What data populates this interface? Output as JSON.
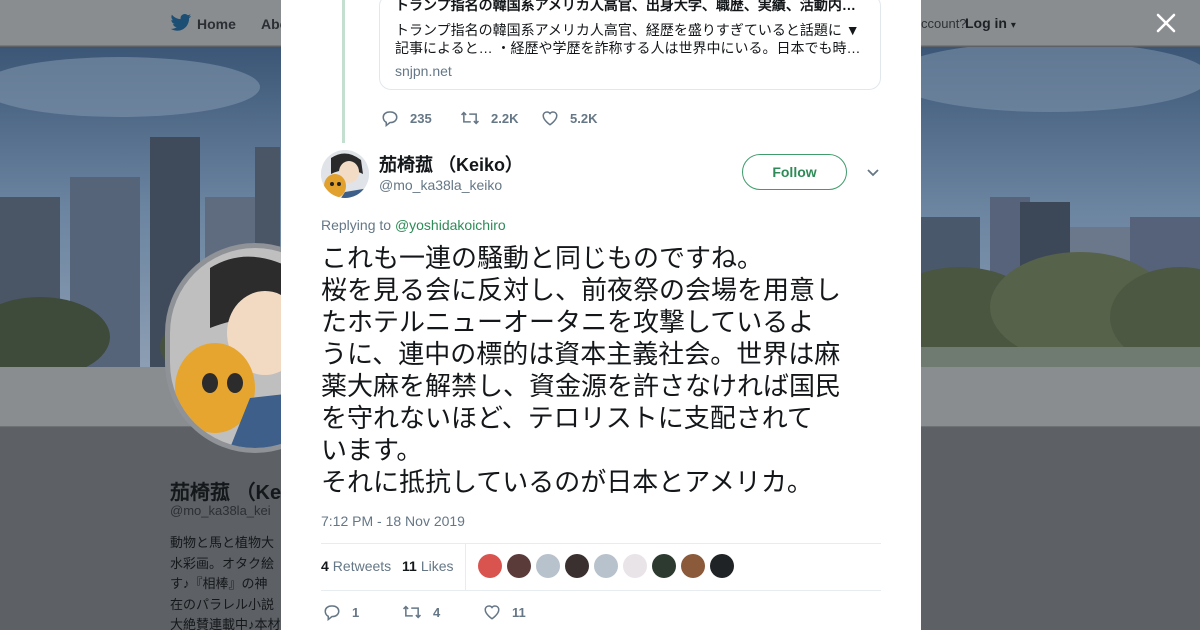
{
  "nav": {
    "home_label": "Home",
    "about_label": "Abo",
    "account_label": "ccount?",
    "login_label": "Log in"
  },
  "profile": {
    "name": "茄椅菰 （Ke",
    "handle": "@mo_ka38la_kei",
    "bio_lines": [
      "動物と馬と植物大",
      "水彩画。オタク絵",
      "す♪『相棒』の神",
      "在のパラレル小説",
      "大絶賛連載中♪本材"
    ]
  },
  "quoted_card": {
    "title": "トランプ指名の韓国系アメリカ人高官、出身大学、職歴、実績、活動内…",
    "desc_lines": [
      "トランプ指名の韓国系アメリカ人高官、経歴を盛りすぎていると話題に ▼",
      "記事によると… ・経歴や学歴を詐称する人は世界中にいる。日本でも時…"
    ],
    "domain": "snjpn.net"
  },
  "prev_actions": {
    "replies": "235",
    "retweets": "2.2K",
    "likes": "5.2K"
  },
  "tweet": {
    "author_name": "茄椅菰 （Keiko）",
    "author_handle": "@mo_ka38la_keiko",
    "follow_label": "Follow",
    "replying_prefix": "Replying to",
    "replying_to": "@yoshidakoichiro",
    "text_lines": [
      "これも一連の騒動と同じものですね。",
      "桜を見る会に反対し、前夜祭の会場を用意し",
      "たホテルニューオータニを攻撃しているよ",
      "うに、連中の標的は資本主義社会。世界は麻",
      "薬大麻を解禁し、資金源を許さなければ国民",
      "を守れないほど、テロリストに支配されて",
      "います。",
      "それに抵抗しているのが日本とアメリカ。"
    ],
    "timestamp": "7:12 PM - 18 Nov 2019"
  },
  "stats": {
    "retweets_count": "4",
    "retweets_label": "Retweets",
    "likes_count": "11",
    "likes_label": "Likes"
  },
  "liker_avatars": [
    {
      "name": "liker-avatar-1",
      "color": "#d9534f"
    },
    {
      "name": "liker-avatar-2",
      "color": "#5b3a3a"
    },
    {
      "name": "liker-avatar-3",
      "color": "#b8c2cc"
    },
    {
      "name": "liker-avatar-4",
      "color": "#3b3030"
    },
    {
      "name": "liker-avatar-5",
      "color": "#b8c2cc"
    },
    {
      "name": "liker-avatar-6",
      "color": "#e8e4e8"
    },
    {
      "name": "liker-avatar-7",
      "color": "#2c3a30"
    },
    {
      "name": "liker-avatar-8",
      "color": "#8a5a3a"
    },
    {
      "name": "liker-avatar-9",
      "color": "#1f2326"
    }
  ],
  "actions": {
    "replies": "1",
    "retweets": "4",
    "likes": "11"
  },
  "colors": {
    "accent": "#2e8b57",
    "muted": "#657786",
    "text": "#14171a"
  }
}
